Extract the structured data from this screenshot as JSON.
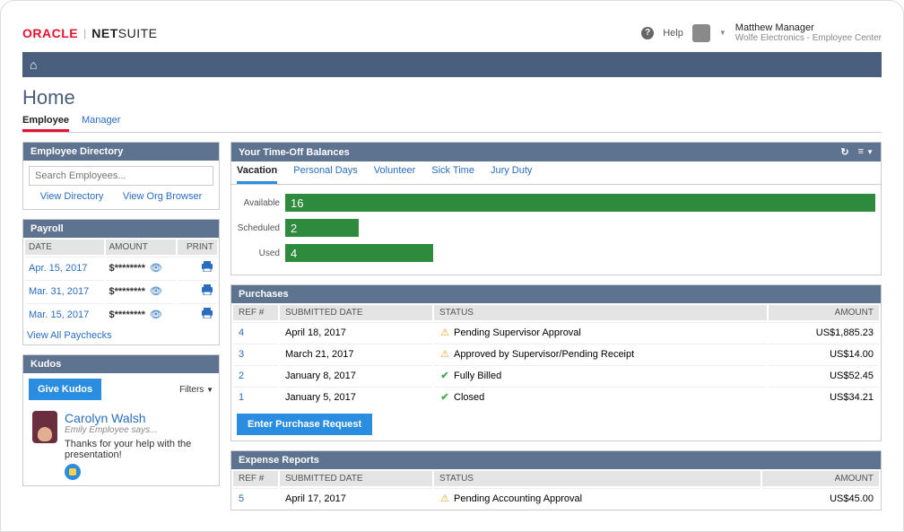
{
  "brand": {
    "oracle": "ORACLE",
    "product": "NETSUITE"
  },
  "header": {
    "help": "Help",
    "user_name": "Matthew Manager",
    "user_sub": "Wolfe Electronics - Employee Center"
  },
  "page": {
    "title": "Home",
    "tabs": [
      "Employee",
      "Manager"
    ],
    "active_tab": 0
  },
  "directory": {
    "title": "Employee Directory",
    "placeholder": "Search Employees...",
    "links": [
      "View Directory",
      "View Org Browser"
    ]
  },
  "payroll": {
    "title": "Payroll",
    "columns": [
      "DATE",
      "AMOUNT",
      "PRINT"
    ],
    "rows": [
      {
        "date": "Apr. 15, 2017",
        "amount": "$********"
      },
      {
        "date": "Mar. 31, 2017",
        "amount": "$********"
      },
      {
        "date": "Mar. 15, 2017",
        "amount": "$********"
      }
    ],
    "view_all": "View All Paychecks"
  },
  "kudos": {
    "title": "Kudos",
    "button": "Give Kudos",
    "filters": "Filters",
    "entry": {
      "name": "Carolyn Walsh",
      "sub": "Emily Employee says...",
      "msg": "Thanks for your help with the presentation!"
    }
  },
  "timeoff": {
    "title": "Your Time-Off Balances",
    "tabs": [
      "Vacation",
      "Personal Days",
      "Volunteer",
      "Sick Time",
      "Jury Duty"
    ],
    "active_tab": 0,
    "rows": [
      {
        "label": "Available",
        "value": 16,
        "max": 16
      },
      {
        "label": "Scheduled",
        "value": 2,
        "max": 16
      },
      {
        "label": "Used",
        "value": 4,
        "max": 16
      }
    ]
  },
  "purchases": {
    "title": "Purchases",
    "columns": [
      "REF #",
      "SUBMITTED DATE",
      "STATUS",
      "AMOUNT"
    ],
    "rows": [
      {
        "ref": "4",
        "date": "April 18, 2017",
        "status": "Pending Supervisor Approval",
        "icon": "warn",
        "amount": "US$1,885.23"
      },
      {
        "ref": "3",
        "date": "March 21, 2017",
        "status": "Approved by Supervisor/Pending Receipt",
        "icon": "warn",
        "amount": "US$14.00"
      },
      {
        "ref": "2",
        "date": "January 8, 2017",
        "status": "Fully Billed",
        "icon": "ok",
        "amount": "US$52.45"
      },
      {
        "ref": "1",
        "date": "January 5, 2017",
        "status": "Closed",
        "icon": "ok",
        "amount": "US$34.21"
      }
    ],
    "button": "Enter Purchase Request"
  },
  "expenses": {
    "title": "Expense Reports",
    "columns": [
      "REF #",
      "SUBMITTED DATE",
      "STATUS",
      "AMOUNT"
    ],
    "rows": [
      {
        "ref": "5",
        "date": "April 17, 2017",
        "status": "Pending Accounting Approval",
        "icon": "warn",
        "amount": "US$45.00"
      }
    ]
  },
  "chart_data": {
    "type": "bar",
    "title": "Your Time-Off Balances — Vacation",
    "categories": [
      "Available",
      "Scheduled",
      "Used"
    ],
    "values": [
      16,
      2,
      4
    ],
    "xlabel": "",
    "ylabel": "",
    "ylim": [
      0,
      16
    ]
  }
}
